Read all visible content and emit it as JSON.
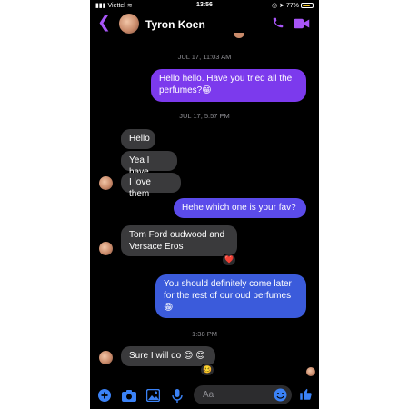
{
  "status_bar": {
    "carrier": "Viettel",
    "time": "13:56",
    "battery": "77%",
    "battery_level": 0.77
  },
  "header": {
    "contact_name": "Tyron Koen"
  },
  "messages": {
    "ts1": "JUL 17, 11:03 AM",
    "m1": "Hello hello. Have you tried all the perfumes?",
    "m1_emoji": "😁",
    "ts2": "JUL 17, 5:57 PM",
    "m2": "Hello",
    "m3": "Yea I have",
    "m4": "I love them",
    "m5": "Hehe which one is your fav?",
    "m6_line1": "Tom Ford oudwood and",
    "m6_line2": "Versace Eros",
    "m6_reaction": "❤️",
    "m7_line1": "You should definitely come later",
    "m7_line2": "for the rest of our oud perfumes",
    "m7_emoji": "😁",
    "ts3": "1:38 PM",
    "m8": "Sure I will do",
    "m8_emoji": "😊 😊",
    "m8_reaction": "🥴"
  },
  "composer": {
    "placeholder": "Aa"
  },
  "colors": {
    "accent": "#a855f7",
    "bubble_out_purple": "#7c3aed",
    "bubble_out_blue": "#3b5bdb",
    "bubble_in": "#3a3a3c"
  },
  "icons": [
    "back-icon",
    "phone-icon",
    "video-icon",
    "plus-icon",
    "camera-icon",
    "photo-icon",
    "mic-icon",
    "emoji-icon",
    "like-icon"
  ]
}
